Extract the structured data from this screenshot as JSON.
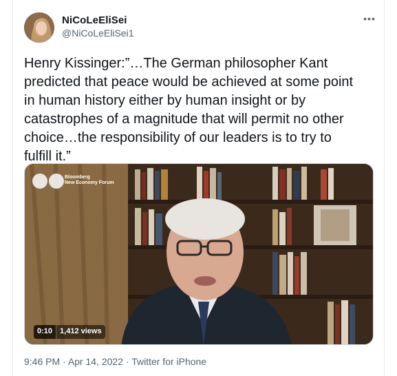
{
  "author": {
    "display_name": "NiCoLeEliSei",
    "handle": "@NiCoLeEliSei1"
  },
  "tweet": {
    "text": "Henry Kissinger:”…The German philosopher Kant\npredicted that peace would be achieved at some point\nin human history either by human insight or by\ncatastrophes of a magnitude that will permit no other\nchoice…the responsibility of our leaders is to try to\nfulfill it.”",
    "menu_glyph": "•••"
  },
  "media": {
    "logo_line1": "Bloomberg",
    "logo_line2": "New Economy Forum",
    "elapsed": "0:10",
    "views": "1,412 views"
  },
  "meta": {
    "time": "9:46 PM",
    "separator": " · ",
    "date": "Apr 14, 2022",
    "source": "Twitter for iPhone"
  },
  "colors": {
    "text": "#0f1419",
    "secondary": "#536471",
    "border": "#e6ecf0"
  }
}
